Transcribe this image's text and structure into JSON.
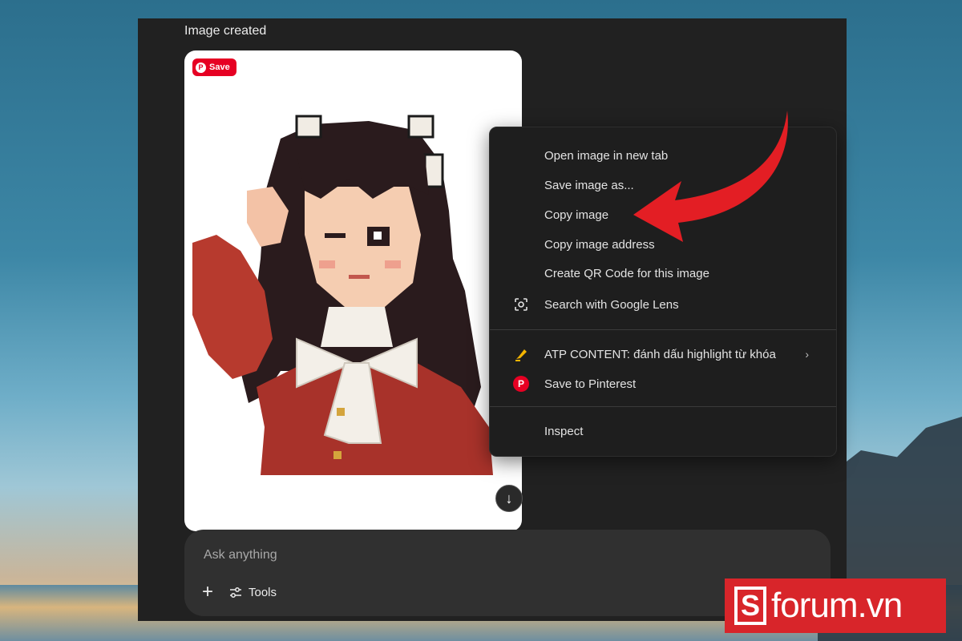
{
  "chat": {
    "caption": "Image created",
    "pinterest_save_label": "Save",
    "input_placeholder": "Ask anything",
    "tools_label": "Tools"
  },
  "context_menu": {
    "items": [
      {
        "label": "Open image in new tab"
      },
      {
        "label": "Save image as..."
      },
      {
        "label": "Copy image"
      },
      {
        "label": "Copy image address"
      },
      {
        "label": "Create QR Code for this image"
      },
      {
        "label": "Search with Google Lens",
        "icon": "google-lens-icon"
      },
      {
        "label": "ATP CONTENT: đánh dấu highlight từ khóa",
        "icon": "highlighter-icon",
        "submenu": true
      },
      {
        "label": "Save to Pinterest",
        "icon": "pinterest-icon"
      },
      {
        "label": "Inspect"
      }
    ]
  },
  "watermark": {
    "letter": "S",
    "text": "forum.vn"
  },
  "colors": {
    "accent_arrow": "#e31e24",
    "pinterest": "#e60023",
    "logo_bg": "#d8252a"
  }
}
